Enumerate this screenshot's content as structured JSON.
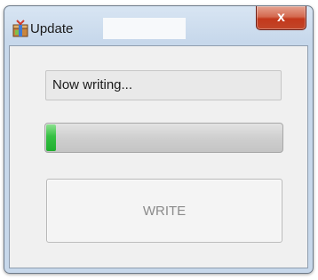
{
  "window": {
    "title": "Update",
    "icon": "package-icon",
    "close_label": "x",
    "close_color": "#c3381c"
  },
  "status": {
    "text": "Now writing..."
  },
  "progress": {
    "percent": 5,
    "color": "#36c043"
  },
  "buttons": {
    "write_label": "WRITE",
    "write_enabled": false
  }
}
